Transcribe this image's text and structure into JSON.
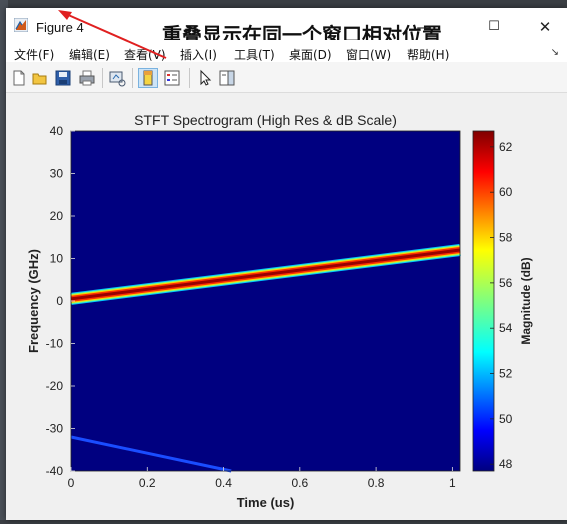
{
  "window": {
    "title": "Figure 4",
    "overlay_text": "重叠显示在同一个窗口相对位置",
    "minimize_symbol": "—",
    "maximize_symbol": "☐",
    "close_symbol": "✕"
  },
  "menu": {
    "items": [
      {
        "label": "文件(F)"
      },
      {
        "label": "编辑(E)"
      },
      {
        "label": "查看(V)"
      },
      {
        "label": "插入(I)"
      },
      {
        "label": "工具(T)"
      },
      {
        "label": "桌面(D)"
      },
      {
        "label": "窗口(W)"
      },
      {
        "label": "帮助(H)"
      }
    ],
    "overflow_symbol": "↘"
  },
  "toolbar": {
    "icons": [
      "new-figure-icon",
      "open-file-icon",
      "save-icon",
      "print-icon",
      "link-plot-icon",
      "colorbar-toggle-icon",
      "legend-toggle-icon",
      "pointer-icon",
      "property-editor-icon"
    ]
  },
  "colors": {
    "background_blue": "#000080",
    "signal_dark_red": "#a00000",
    "arrow_red": "#e02020"
  },
  "chart_data": {
    "type": "heatmap",
    "title": "STFT Spectrogram (High Res & dB Scale)",
    "xlabel": "Time (us)",
    "ylabel": "Frequency (GHz)",
    "xlim": [
      0,
      1.02
    ],
    "ylim": [
      -40,
      40
    ],
    "xticks": [
      "0",
      "0.2",
      "0.4",
      "0.6",
      "0.8",
      "1"
    ],
    "yticks": [
      "40",
      "30",
      "20",
      "10",
      "0",
      "-10",
      "-20",
      "-30",
      "-40"
    ],
    "colorbar": {
      "label": "Magnitude (dB)",
      "range": [
        47.7,
        62.7
      ],
      "ticks": [
        "62",
        "60",
        "58",
        "56",
        "54",
        "52",
        "50",
        "48"
      ]
    },
    "features": [
      {
        "name": "chirp",
        "x": [
          0,
          1.02
        ],
        "y": [
          0.5,
          12.0
        ],
        "level_db": 62
      },
      {
        "name": "alias",
        "x": [
          0,
          0.42
        ],
        "y": [
          -32,
          -40
        ],
        "level_db": 50
      }
    ]
  }
}
